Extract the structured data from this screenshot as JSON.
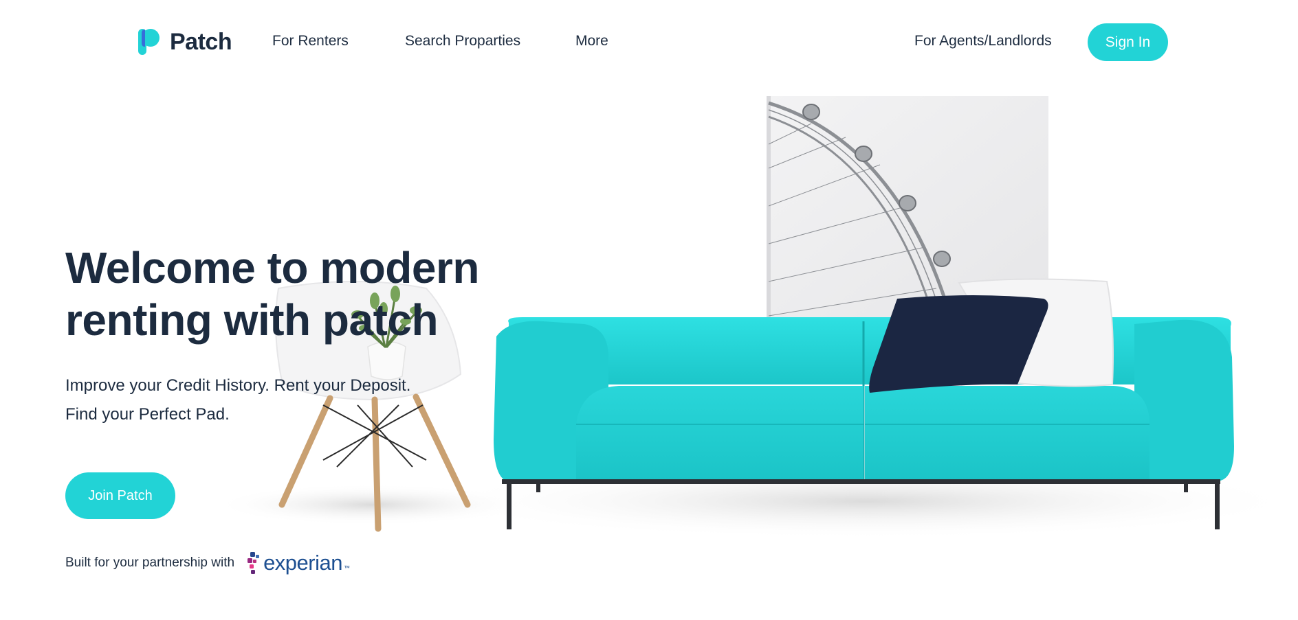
{
  "brand": {
    "name": "Patch",
    "accent": "#22d3d6",
    "dark": "#1c2b3f"
  },
  "nav": {
    "for_renters": "For Renters",
    "search_properties": "Search Proparties",
    "more": "More",
    "for_agents": "For Agents/Landlords",
    "sign_in": "Sign In"
  },
  "hero": {
    "title_line1": "Welcome to modern",
    "title_line2": "renting with patch",
    "subtitle_line1": "Improve your Credit History. Rent your Deposit.",
    "subtitle_line2": "Find your Perfect Pad.",
    "cta": "Join Patch"
  },
  "partnership": {
    "text": "Built for your partnership with",
    "partner_name": "experian",
    "partner_tm": "™"
  },
  "icons": {
    "logo": "patch-logo-icon"
  }
}
